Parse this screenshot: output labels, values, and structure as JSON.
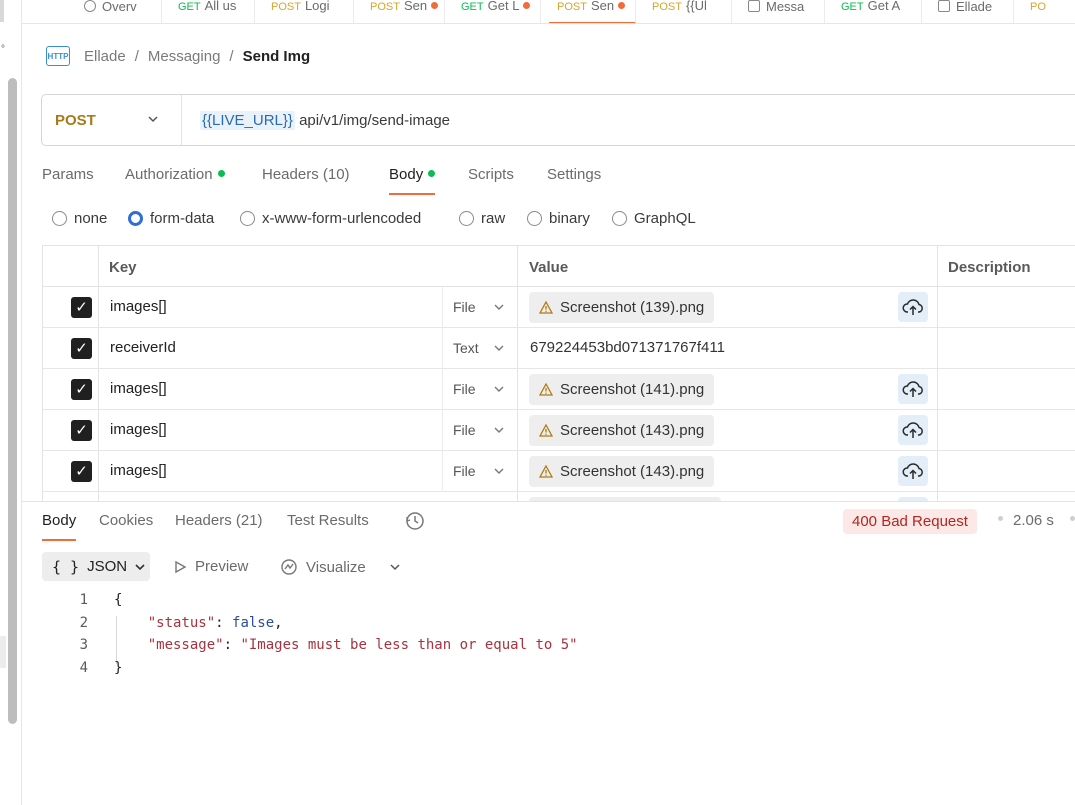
{
  "tabs": [
    {
      "method": "",
      "label": "Overv",
      "dot": false,
      "icon": "overview-icon"
    },
    {
      "method": "GET",
      "label": "All us",
      "dot": false
    },
    {
      "method": "POST",
      "label": "Logi",
      "dot": false
    },
    {
      "method": "POST",
      "label": "Sen",
      "dot": true
    },
    {
      "method": "GET",
      "label": "Get L",
      "dot": true
    },
    {
      "method": "POST",
      "label": "Sen",
      "dot": true,
      "active": true
    },
    {
      "method": "POST",
      "label": "{{Ul",
      "dot": false
    },
    {
      "method": "",
      "label": "Messa",
      "dot": false,
      "icon": "message-icon"
    },
    {
      "method": "GET",
      "label": "Get A",
      "dot": false
    },
    {
      "method": "",
      "label": "Ellade",
      "dot": false,
      "icon": "doc-icon"
    },
    {
      "method": "PO",
      "label": "",
      "dot": false
    }
  ],
  "breadcrumb": {
    "icon_text": "HTTP",
    "items": [
      "Ellade",
      "Messaging"
    ],
    "current": "Send Img",
    "separator": "/"
  },
  "request": {
    "method": "POST",
    "url_var": "{{LIVE_URL}}",
    "url_path": "api/v1/img/send-image"
  },
  "request_tabs": [
    {
      "label": "Params",
      "count": "",
      "dot": false
    },
    {
      "label": "Authorization",
      "count": "",
      "dot": true
    },
    {
      "label": "Headers",
      "count": "(10)",
      "dot": false
    },
    {
      "label": "Body",
      "count": "",
      "dot": true,
      "active": true
    },
    {
      "label": "Scripts",
      "count": "",
      "dot": false
    },
    {
      "label": "Settings",
      "count": "",
      "dot": false
    }
  ],
  "body_types": [
    {
      "label": "none",
      "selected": false
    },
    {
      "label": "form-data",
      "selected": true
    },
    {
      "label": "x-www-form-urlencoded",
      "selected": false
    },
    {
      "label": "raw",
      "selected": false
    },
    {
      "label": "binary",
      "selected": false
    },
    {
      "label": "GraphQL",
      "selected": false
    }
  ],
  "table": {
    "headers": {
      "key": "Key",
      "value": "Value",
      "description": "Description"
    },
    "rows": [
      {
        "checked": true,
        "key": "images[]",
        "type": "File",
        "value": "Screenshot (139).png",
        "is_file": true
      },
      {
        "checked": true,
        "key": "receiverId",
        "type": "Text",
        "value": "679224453bd071371767f411",
        "is_file": false
      },
      {
        "checked": true,
        "key": "images[]",
        "type": "File",
        "value": "Screenshot (141).png",
        "is_file": true
      },
      {
        "checked": true,
        "key": "images[]",
        "type": "File",
        "value": "Screenshot (143).png",
        "is_file": true
      },
      {
        "checked": true,
        "key": "images[]",
        "type": "File",
        "value": "Screenshot (143).png",
        "is_file": true
      }
    ]
  },
  "response": {
    "tabs": [
      {
        "label": "Body",
        "active": true
      },
      {
        "label": "Cookies",
        "active": false
      },
      {
        "label": "Headers (21)",
        "active": false
      },
      {
        "label": "Test Results",
        "active": false
      }
    ],
    "status": "400 Bad Request",
    "time": "2.06 s",
    "format": {
      "braces": "{ }",
      "label": "JSON"
    },
    "preview_label": "Preview",
    "visualize_label": "Visualize",
    "lines": [
      {
        "n": "1",
        "text": "{"
      },
      {
        "n": "2",
        "key": "\"status\"",
        "value": "false",
        "value_type": "bool",
        "comma": true
      },
      {
        "n": "3",
        "key": "\"message\"",
        "value": "\"Images must be less than or equal to 5\"",
        "value_type": "string",
        "comma": false
      },
      {
        "n": "4",
        "text": "}"
      }
    ]
  },
  "colors": {
    "accent": "#f26b3a",
    "get": "#0cbb52",
    "post": "#d8a52a",
    "error_bg": "#fce9e7",
    "error_text": "#b3261e"
  }
}
